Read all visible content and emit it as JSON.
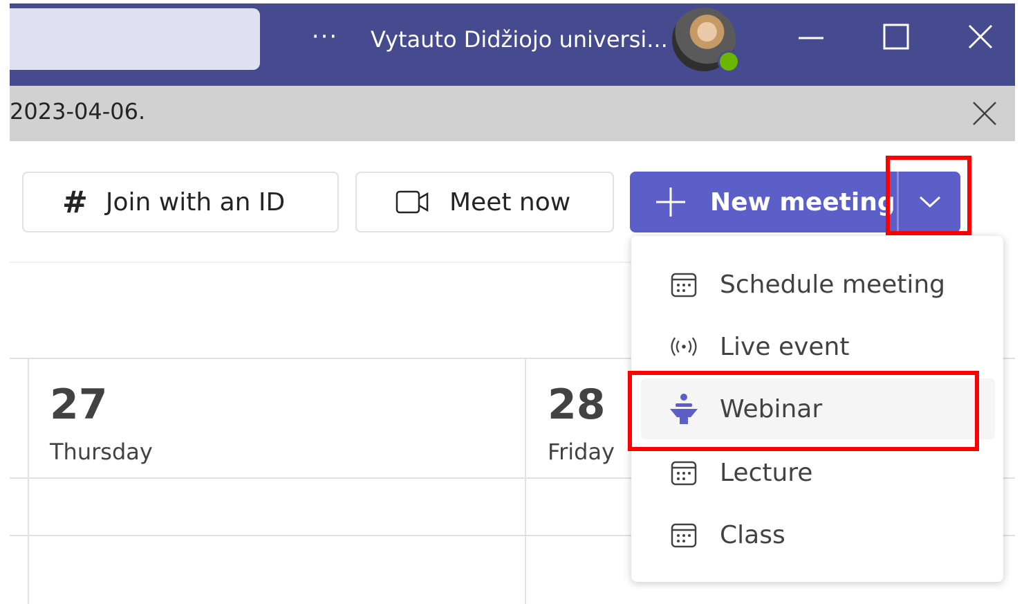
{
  "titlebar": {
    "more_glyph": "···",
    "org_name": "Vytauto Didžiojo universi...",
    "presence": "available",
    "colors": {
      "background": "#464b8f",
      "presence": "#6bb700"
    }
  },
  "banner": {
    "text": "2023-04-06."
  },
  "toolbar": {
    "join_label": "Join with an ID",
    "join_glyph": "#",
    "meet_label": "Meet now",
    "new_label": "New meeting",
    "accent": "#5b5fc7"
  },
  "menu": {
    "items": [
      {
        "label": "Schedule meeting",
        "icon": "calendar-icon"
      },
      {
        "label": "Live event",
        "icon": "broadcast-icon"
      },
      {
        "label": "Webinar",
        "icon": "webinar-icon",
        "active": true
      },
      {
        "label": "Lecture",
        "icon": "calendar-icon"
      },
      {
        "label": "Class",
        "icon": "calendar-icon"
      }
    ]
  },
  "calendar": {
    "days": [
      {
        "num": "27",
        "name": "Thursday"
      },
      {
        "num": "28",
        "name": "Friday"
      }
    ]
  },
  "annotation": {
    "color": "#ff0000"
  }
}
